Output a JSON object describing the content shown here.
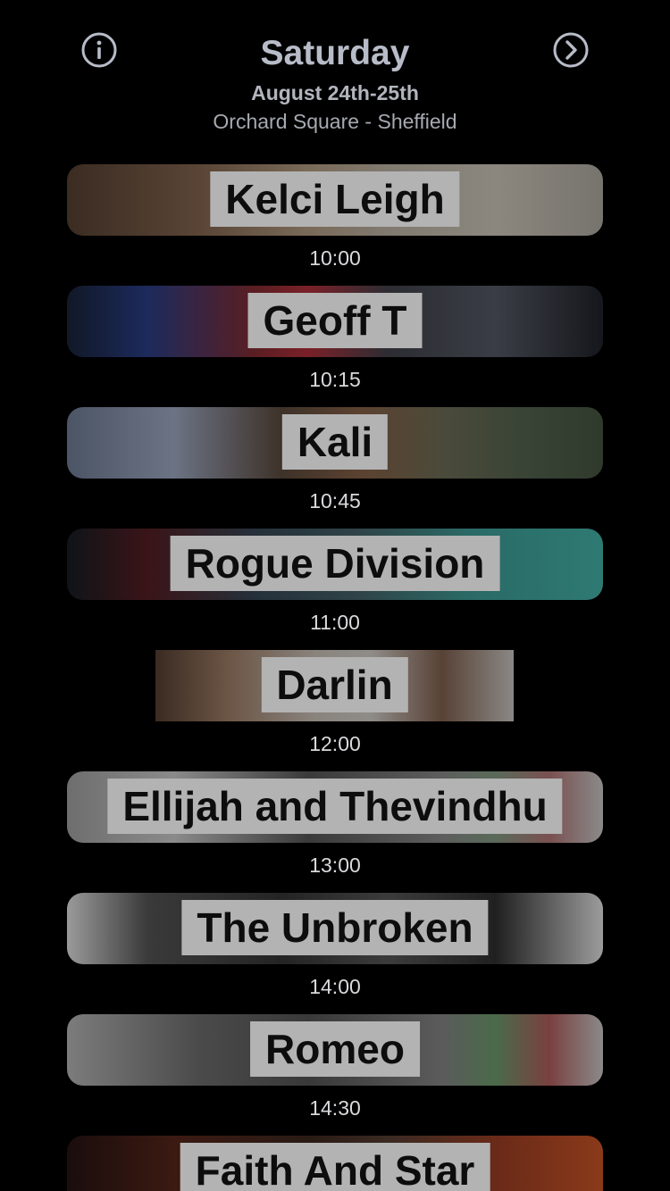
{
  "header": {
    "title": "Saturday",
    "dates": "August 24th-25th",
    "venue": "Orchard Square - Sheffield",
    "info_icon": "info-circle-icon",
    "next_icon": "chevron-right-circle-icon"
  },
  "colors": {
    "background": "#000000",
    "title": "#b7bcc8",
    "name_box": "#b3b3b3",
    "name_text": "#0d0d0d",
    "time_text": "#d9dadd"
  },
  "acts": [
    {
      "name": "Kelci Leigh",
      "time": "10:00"
    },
    {
      "name": "Geoff T",
      "time": "10:15"
    },
    {
      "name": "Kali",
      "time": "10:45"
    },
    {
      "name": "Rogue Division",
      "time": "11:00"
    },
    {
      "name": "Darlin",
      "time": "12:00"
    },
    {
      "name": "Ellijah and Thevindhu",
      "time": "13:00"
    },
    {
      "name": "The Unbroken",
      "time": "14:00"
    },
    {
      "name": "Romeo",
      "time": "14:30"
    },
    {
      "name": "Faith And Star",
      "time": ""
    }
  ]
}
